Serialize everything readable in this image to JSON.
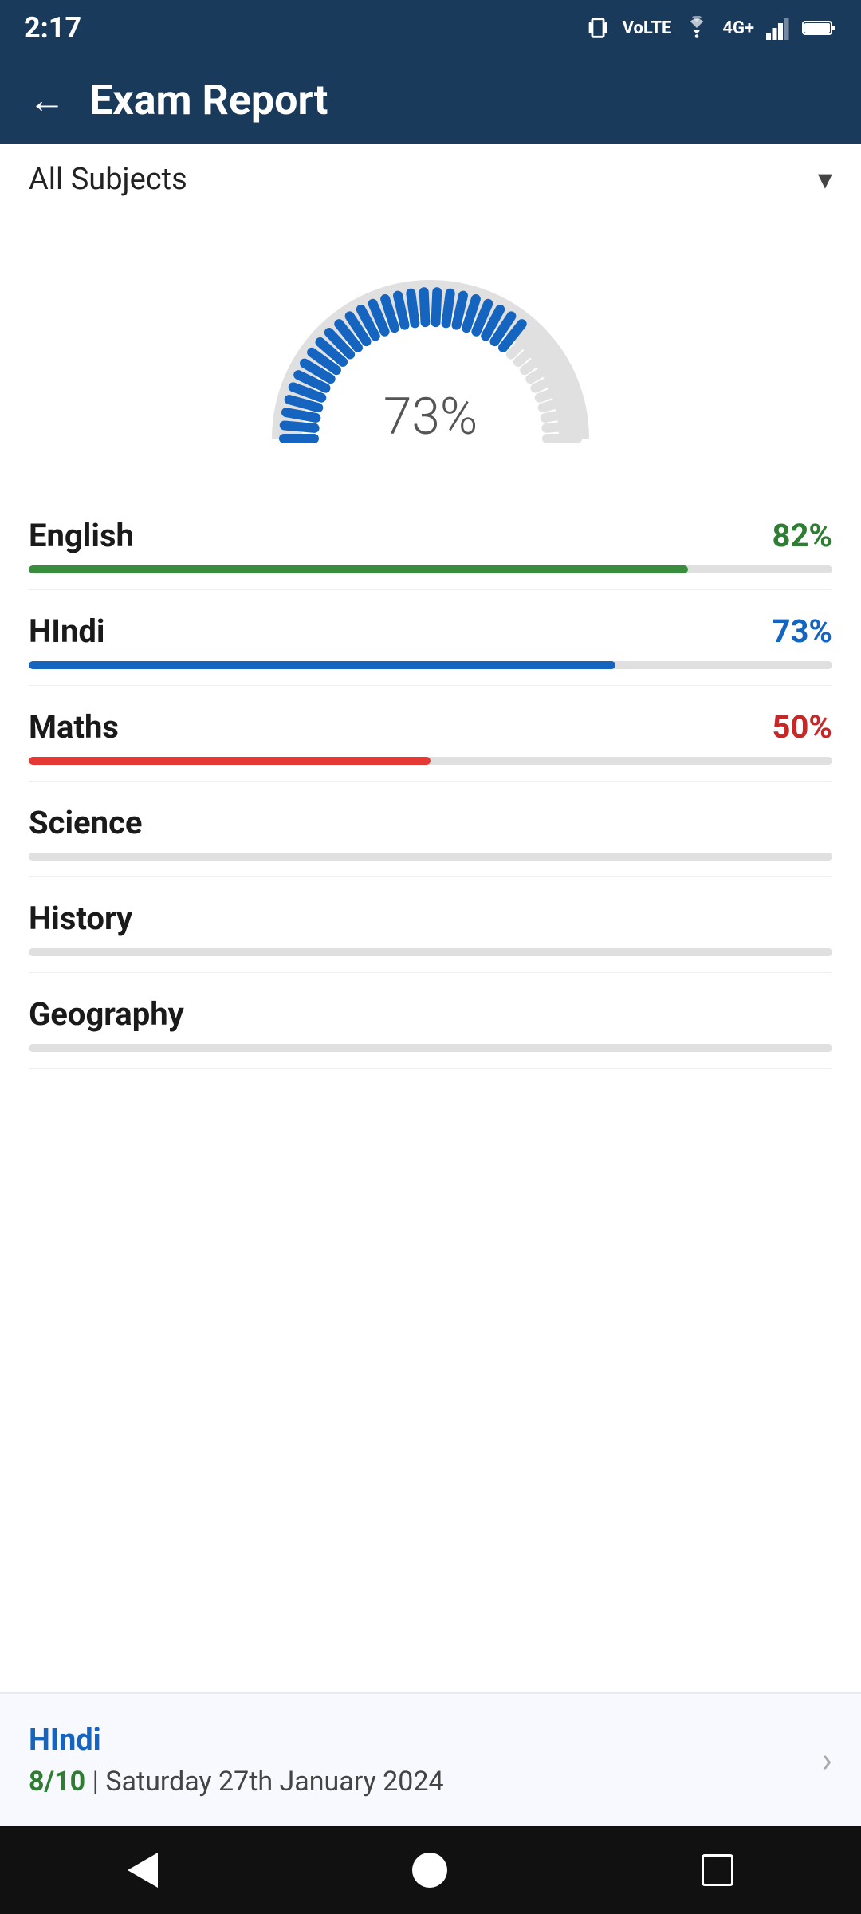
{
  "statusBar": {
    "time": "2:17",
    "icons": [
      "vibrate",
      "volte",
      "wifi",
      "4g",
      "signal",
      "battery"
    ]
  },
  "header": {
    "backLabel": "←",
    "title": "Exam Report"
  },
  "subjectDropdown": {
    "label": "All Subjects",
    "chevron": "▾"
  },
  "gauge": {
    "percent": "73%",
    "value": 73
  },
  "subjects": [
    {
      "name": "English",
      "percent": "82%",
      "value": 82,
      "colorClass": "fill-green",
      "percentClass": "percent-green"
    },
    {
      "name": "HIndi",
      "percent": "73%",
      "value": 73,
      "colorClass": "fill-blue",
      "percentClass": "percent-blue"
    },
    {
      "name": "Maths",
      "percent": "50%",
      "value": 50,
      "colorClass": "fill-red",
      "percentClass": "percent-red"
    },
    {
      "name": "Science",
      "percent": "",
      "value": 0,
      "colorClass": "fill-gray",
      "percentClass": ""
    },
    {
      "name": "History",
      "percent": "",
      "value": 0,
      "colorClass": "fill-gray",
      "percentClass": ""
    },
    {
      "name": "Geography",
      "percent": "",
      "value": 0,
      "colorClass": "fill-gray",
      "percentClass": ""
    }
  ],
  "recentExam": {
    "subject": "HIndi",
    "score": "8/10",
    "date": "Saturday 27th January 2024",
    "chevron": "›"
  },
  "bottomNav": {
    "back": "back",
    "home": "home",
    "recents": "recents"
  }
}
